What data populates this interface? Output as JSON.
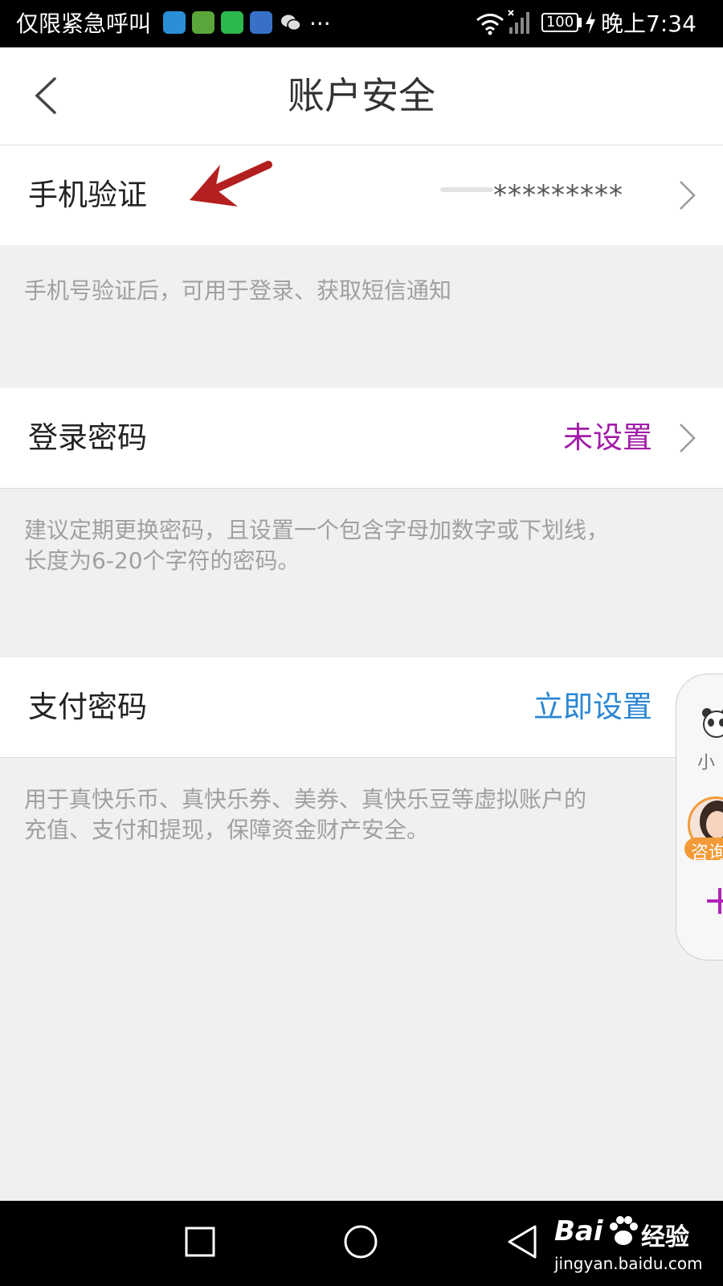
{
  "statusbar": {
    "carrier": "仅限紧急呼叫",
    "more": "···",
    "battery": "100",
    "time": "晚上7:34"
  },
  "header": {
    "title": "账户安全"
  },
  "phone": {
    "label": "手机验证",
    "value": "*********",
    "desc": "手机号验证后，可用于登录、获取短信通知"
  },
  "login": {
    "label": "登录密码",
    "value": "未设置",
    "value_color": "#a21ca8",
    "desc_line1": "建议定期更换密码，且设置一个包含字母加数字或下划线，",
    "desc_line2": "长度为6-20个字符的密码。"
  },
  "pay": {
    "label": "支付密码",
    "value": "立即设置",
    "value_color": "#2b87d4",
    "desc_line1": "用于真快乐币、真快乐券、美券、真快乐豆等虚拟账户的",
    "desc_line2": "充值、支付和提现，保障资金财产安全。"
  },
  "float_widget": {
    "assistant_label": "小",
    "consult_label": "咨询"
  },
  "watermark": {
    "brand": "Bai",
    "brand_cn": "经验",
    "url": "jingyan.baidu.com"
  },
  "icons": [
    "back-icon",
    "chevron-right-icon",
    "wifi-icon",
    "signal-icon",
    "battery-icon",
    "red-arrow-annotation"
  ]
}
